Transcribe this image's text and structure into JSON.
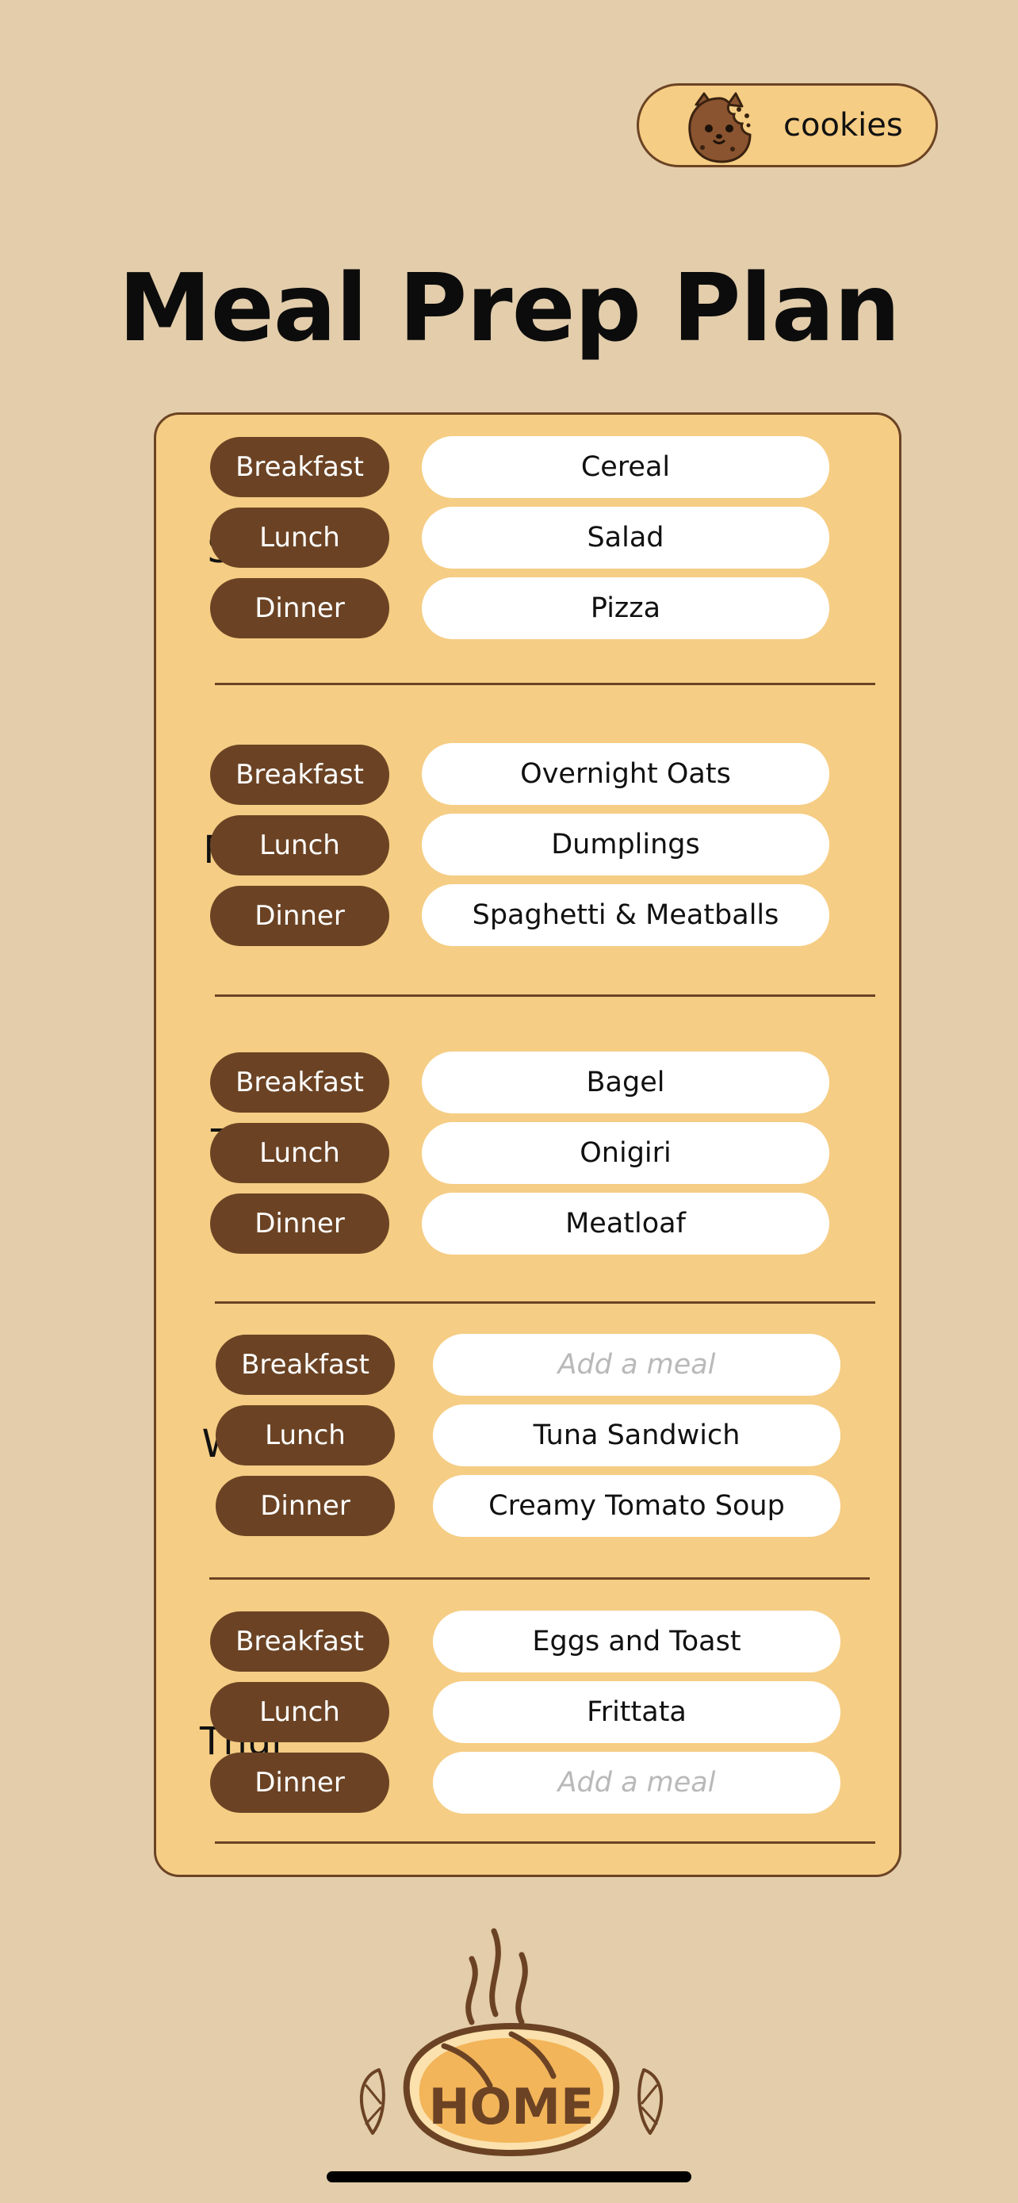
{
  "header": {
    "cookies_label": "cookies",
    "title": "Meal Prep Plan"
  },
  "days": [
    {
      "day": "Sun",
      "meals": [
        {
          "type": "Breakfast",
          "value": "Cereal",
          "placeholder": ""
        },
        {
          "type": "Lunch",
          "value": "Salad",
          "placeholder": ""
        },
        {
          "type": "Dinner",
          "value": "Pizza",
          "placeholder": ""
        }
      ]
    },
    {
      "day": "Mon",
      "meals": [
        {
          "type": "Breakfast",
          "value": "Overnight Oats",
          "placeholder": ""
        },
        {
          "type": "Lunch",
          "value": "Dumplings",
          "placeholder": ""
        },
        {
          "type": "Dinner",
          "value": "Spaghetti & Meatballs",
          "placeholder": ""
        }
      ]
    },
    {
      "day": "Tue",
      "meals": [
        {
          "type": "Breakfast",
          "value": "Bagel",
          "placeholder": ""
        },
        {
          "type": "Lunch",
          "value": "Onigiri",
          "placeholder": ""
        },
        {
          "type": "Dinner",
          "value": "Meatloaf",
          "placeholder": ""
        }
      ]
    },
    {
      "day": "Wed",
      "meals": [
        {
          "type": "Breakfast",
          "value": "",
          "placeholder": "Add a meal"
        },
        {
          "type": "Lunch",
          "value": "Tuna Sandwich",
          "placeholder": ""
        },
        {
          "type": "Dinner",
          "value": "Creamy Tomato Soup",
          "placeholder": ""
        }
      ]
    },
    {
      "day": "Thur",
      "meals": [
        {
          "type": "Breakfast",
          "value": "Eggs and Toast",
          "placeholder": ""
        },
        {
          "type": "Lunch",
          "value": "Frittata",
          "placeholder": ""
        },
        {
          "type": "Dinner",
          "value": "",
          "placeholder": "Add a meal"
        }
      ]
    }
  ],
  "home_button": {
    "label": "HOME",
    "icon": "bread-loaf-icon"
  },
  "colors": {
    "background": "#e3cdab",
    "card": "#f5cd84",
    "accent_brown": "#6b4324",
    "input_bg": "#ffffff",
    "placeholder": "#b9b9b9"
  }
}
